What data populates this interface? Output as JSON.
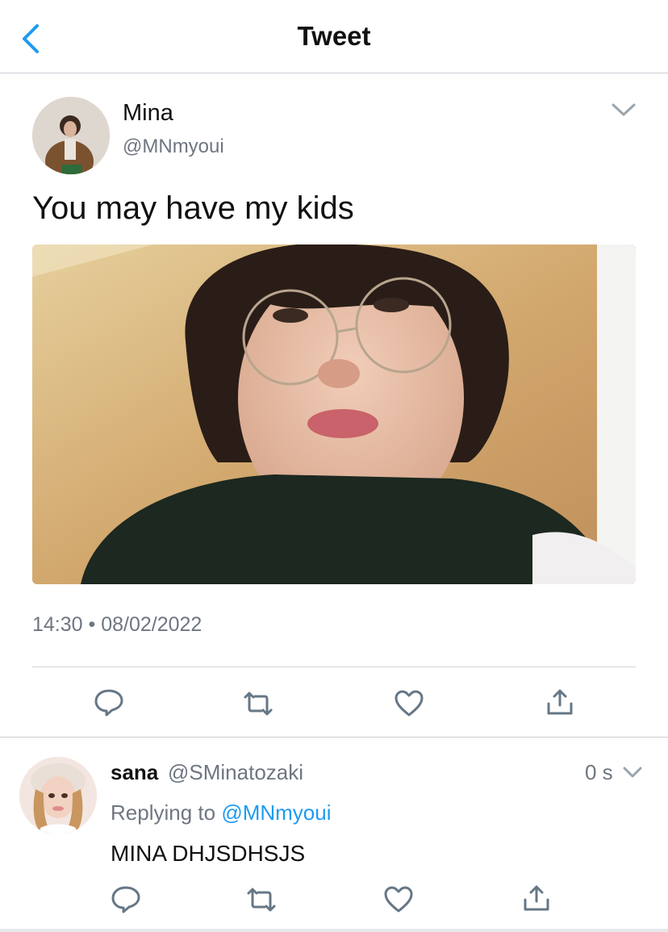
{
  "header": {
    "title": "Tweet",
    "back_icon": "chevron-left-icon"
  },
  "tweet": {
    "author_name": "Mina",
    "author_handle": "@MNmyoui",
    "text": "You may have my kids",
    "timestamp": "14:30 • 08/02/2022",
    "actions": [
      "reply-icon",
      "retweet-icon",
      "like-icon",
      "share-icon"
    ]
  },
  "reply": {
    "author_name": "sana",
    "author_handle": "@SMinatozaki",
    "time": "0 s",
    "replying_prefix": "Replying to",
    "replying_to": "@MNmyoui",
    "text": "MINA DHJSDHSJS",
    "actions": [
      "reply-icon",
      "retweet-icon",
      "like-icon",
      "share-icon"
    ]
  },
  "colors": {
    "accent": "#1d9bf0",
    "muted": "#6e7681",
    "icon": "#667786"
  }
}
